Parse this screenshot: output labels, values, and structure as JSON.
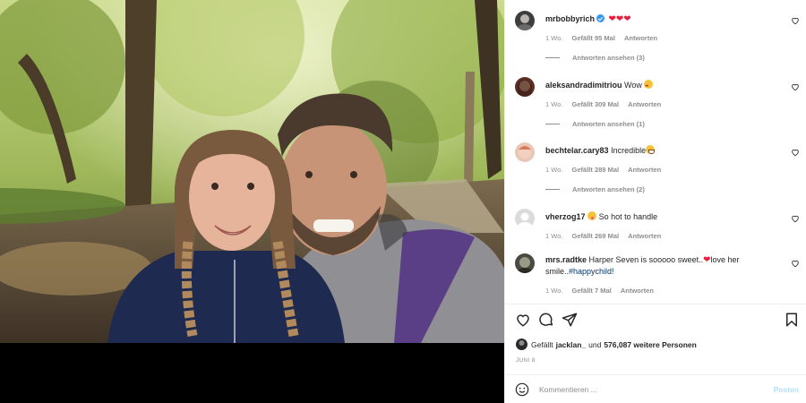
{
  "comments": [
    {
      "user": "mrbobbyrich",
      "verified": true,
      "text": "❤❤❤",
      "time": "1 Wo.",
      "likes": "Gefällt 95 Mal",
      "reply": "Antworten",
      "view_replies": "Antworten ansehen (3)"
    },
    {
      "user": "aleksandradimitriou",
      "text": "Wow",
      "time": "1 Wo.",
      "likes": "Gefällt 309 Mal",
      "reply": "Antworten",
      "view_replies": "Antworten ansehen (1)"
    },
    {
      "user": "bechtelar.cary83",
      "text": "Incredible",
      "time": "1 Wo.",
      "likes": "Gefällt 289 Mal",
      "reply": "Antworten",
      "view_replies": "Antworten ansehen (2)"
    },
    {
      "user": "vherzog17",
      "text": "So hot to handle",
      "time": "1 Wo.",
      "likes": "Gefällt 269 Mal",
      "reply": "Antworten"
    },
    {
      "user": "mrs.radtke",
      "text_a": "Harper Seven is sooooo sweet..",
      "text_b": "love her smile..",
      "hashtag": "#happychild!",
      "time": "1 Wo.",
      "likes": "Gefällt 7 Mal",
      "reply": "Antworten"
    }
  ],
  "likes_line": {
    "prefix": "Gefällt",
    "user": "jacklan_",
    "middle": "und",
    "count": "576,087 weitere Personen"
  },
  "date": "JUNI 8",
  "comment_box": {
    "placeholder": "Kommentieren ...",
    "post": "Posten"
  },
  "icons": [
    "heart-icon",
    "comment-icon",
    "share-icon",
    "bookmark-icon",
    "emoji-icon",
    "verified-badge-icon"
  ],
  "colors": {
    "heart_red": "#ed1c3a",
    "verified_blue": "#3897f0",
    "post_disabled": "#b2dffc",
    "meta_gray": "#8e8e8e"
  }
}
